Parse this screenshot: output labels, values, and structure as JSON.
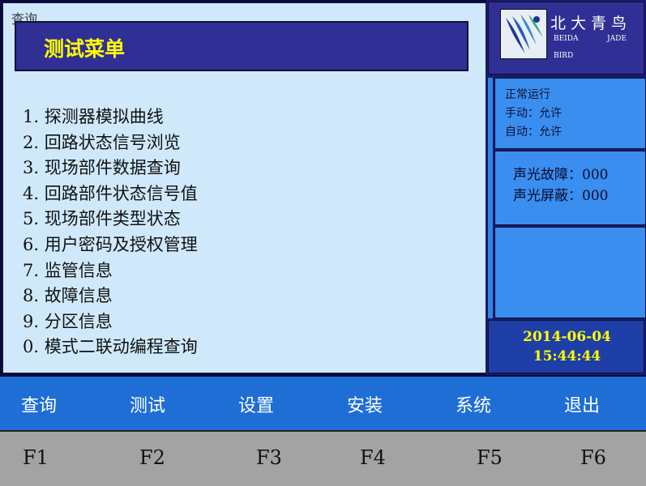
{
  "main": {
    "ghost_text": "查询",
    "title": "测试菜单",
    "menu_items": [
      "1. 探测器模拟曲线",
      "2. 回路状态信号浏览",
      "3. 现场部件数据查询",
      "4. 回路部件状态信号值",
      "5. 现场部件类型状态",
      "6. 用户密码及授权管理",
      "7. 监管信息",
      "8. 故障信息",
      "9. 分区信息",
      "0. 模式二联动编程查询"
    ]
  },
  "logo": {
    "cn": "北大青鸟",
    "en_beida": "BEIDA",
    "en_jade": "JADE",
    "en_bird": "BIRD"
  },
  "status": {
    "running": "正常运行",
    "manual": "手动：允许",
    "auto": "自动：允许"
  },
  "alarm": {
    "fault": "声光故障：000",
    "mask": "声光屏蔽：000"
  },
  "datetime": {
    "date": "2014-06-04",
    "time": "15:44:44"
  },
  "function_bar": [
    "查询",
    "测试",
    "设置",
    "安装",
    "系统",
    "退出"
  ],
  "keys": [
    "F1",
    "F2",
    "F3",
    "F4",
    "F5",
    "F6"
  ],
  "colors": {
    "title_text": "#ffff00",
    "panel_blue": "#3a8ef0",
    "function_bar": "#1e6ed6",
    "key_bar": "#a3a3a3"
  }
}
